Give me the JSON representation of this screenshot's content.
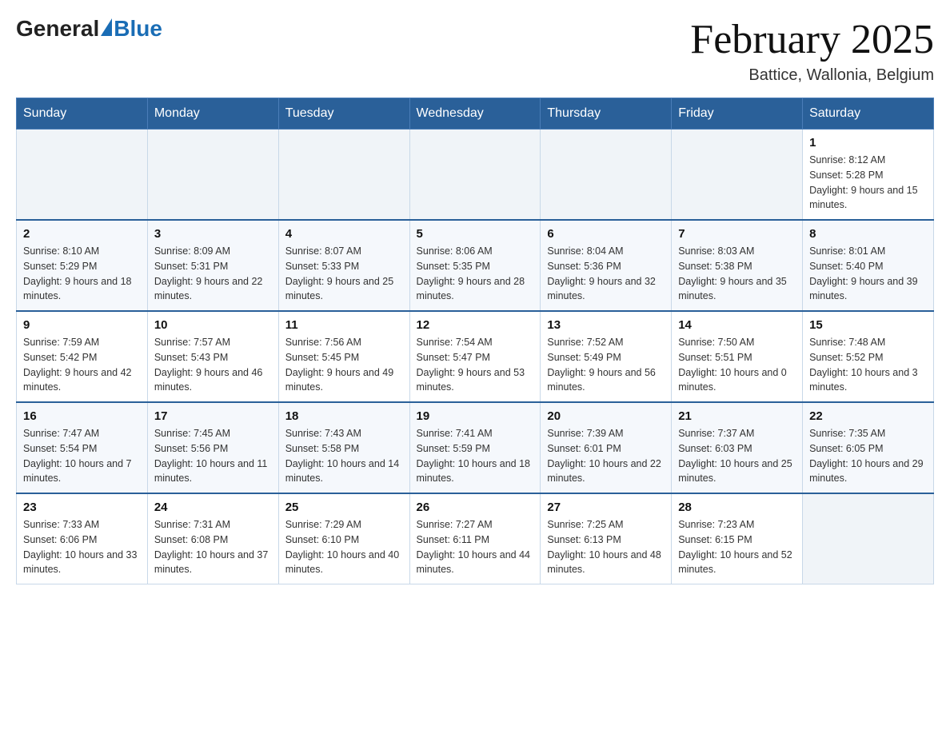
{
  "header": {
    "logo_general": "General",
    "logo_blue": "Blue",
    "month_title": "February 2025",
    "location": "Battice, Wallonia, Belgium"
  },
  "days_of_week": [
    "Sunday",
    "Monday",
    "Tuesday",
    "Wednesday",
    "Thursday",
    "Friday",
    "Saturday"
  ],
  "weeks": [
    [
      {
        "day": "",
        "sunrise": "",
        "sunset": "",
        "daylight": "",
        "empty": true
      },
      {
        "day": "",
        "sunrise": "",
        "sunset": "",
        "daylight": "",
        "empty": true
      },
      {
        "day": "",
        "sunrise": "",
        "sunset": "",
        "daylight": "",
        "empty": true
      },
      {
        "day": "",
        "sunrise": "",
        "sunset": "",
        "daylight": "",
        "empty": true
      },
      {
        "day": "",
        "sunrise": "",
        "sunset": "",
        "daylight": "",
        "empty": true
      },
      {
        "day": "",
        "sunrise": "",
        "sunset": "",
        "daylight": "",
        "empty": true
      },
      {
        "day": "1",
        "sunrise": "Sunrise: 8:12 AM",
        "sunset": "Sunset: 5:28 PM",
        "daylight": "Daylight: 9 hours and 15 minutes.",
        "empty": false
      }
    ],
    [
      {
        "day": "2",
        "sunrise": "Sunrise: 8:10 AM",
        "sunset": "Sunset: 5:29 PM",
        "daylight": "Daylight: 9 hours and 18 minutes.",
        "empty": false
      },
      {
        "day": "3",
        "sunrise": "Sunrise: 8:09 AM",
        "sunset": "Sunset: 5:31 PM",
        "daylight": "Daylight: 9 hours and 22 minutes.",
        "empty": false
      },
      {
        "day": "4",
        "sunrise": "Sunrise: 8:07 AM",
        "sunset": "Sunset: 5:33 PM",
        "daylight": "Daylight: 9 hours and 25 minutes.",
        "empty": false
      },
      {
        "day": "5",
        "sunrise": "Sunrise: 8:06 AM",
        "sunset": "Sunset: 5:35 PM",
        "daylight": "Daylight: 9 hours and 28 minutes.",
        "empty": false
      },
      {
        "day": "6",
        "sunrise": "Sunrise: 8:04 AM",
        "sunset": "Sunset: 5:36 PM",
        "daylight": "Daylight: 9 hours and 32 minutes.",
        "empty": false
      },
      {
        "day": "7",
        "sunrise": "Sunrise: 8:03 AM",
        "sunset": "Sunset: 5:38 PM",
        "daylight": "Daylight: 9 hours and 35 minutes.",
        "empty": false
      },
      {
        "day": "8",
        "sunrise": "Sunrise: 8:01 AM",
        "sunset": "Sunset: 5:40 PM",
        "daylight": "Daylight: 9 hours and 39 minutes.",
        "empty": false
      }
    ],
    [
      {
        "day": "9",
        "sunrise": "Sunrise: 7:59 AM",
        "sunset": "Sunset: 5:42 PM",
        "daylight": "Daylight: 9 hours and 42 minutes.",
        "empty": false
      },
      {
        "day": "10",
        "sunrise": "Sunrise: 7:57 AM",
        "sunset": "Sunset: 5:43 PM",
        "daylight": "Daylight: 9 hours and 46 minutes.",
        "empty": false
      },
      {
        "day": "11",
        "sunrise": "Sunrise: 7:56 AM",
        "sunset": "Sunset: 5:45 PM",
        "daylight": "Daylight: 9 hours and 49 minutes.",
        "empty": false
      },
      {
        "day": "12",
        "sunrise": "Sunrise: 7:54 AM",
        "sunset": "Sunset: 5:47 PM",
        "daylight": "Daylight: 9 hours and 53 minutes.",
        "empty": false
      },
      {
        "day": "13",
        "sunrise": "Sunrise: 7:52 AM",
        "sunset": "Sunset: 5:49 PM",
        "daylight": "Daylight: 9 hours and 56 minutes.",
        "empty": false
      },
      {
        "day": "14",
        "sunrise": "Sunrise: 7:50 AM",
        "sunset": "Sunset: 5:51 PM",
        "daylight": "Daylight: 10 hours and 0 minutes.",
        "empty": false
      },
      {
        "day": "15",
        "sunrise": "Sunrise: 7:48 AM",
        "sunset": "Sunset: 5:52 PM",
        "daylight": "Daylight: 10 hours and 3 minutes.",
        "empty": false
      }
    ],
    [
      {
        "day": "16",
        "sunrise": "Sunrise: 7:47 AM",
        "sunset": "Sunset: 5:54 PM",
        "daylight": "Daylight: 10 hours and 7 minutes.",
        "empty": false
      },
      {
        "day": "17",
        "sunrise": "Sunrise: 7:45 AM",
        "sunset": "Sunset: 5:56 PM",
        "daylight": "Daylight: 10 hours and 11 minutes.",
        "empty": false
      },
      {
        "day": "18",
        "sunrise": "Sunrise: 7:43 AM",
        "sunset": "Sunset: 5:58 PM",
        "daylight": "Daylight: 10 hours and 14 minutes.",
        "empty": false
      },
      {
        "day": "19",
        "sunrise": "Sunrise: 7:41 AM",
        "sunset": "Sunset: 5:59 PM",
        "daylight": "Daylight: 10 hours and 18 minutes.",
        "empty": false
      },
      {
        "day": "20",
        "sunrise": "Sunrise: 7:39 AM",
        "sunset": "Sunset: 6:01 PM",
        "daylight": "Daylight: 10 hours and 22 minutes.",
        "empty": false
      },
      {
        "day": "21",
        "sunrise": "Sunrise: 7:37 AM",
        "sunset": "Sunset: 6:03 PM",
        "daylight": "Daylight: 10 hours and 25 minutes.",
        "empty": false
      },
      {
        "day": "22",
        "sunrise": "Sunrise: 7:35 AM",
        "sunset": "Sunset: 6:05 PM",
        "daylight": "Daylight: 10 hours and 29 minutes.",
        "empty": false
      }
    ],
    [
      {
        "day": "23",
        "sunrise": "Sunrise: 7:33 AM",
        "sunset": "Sunset: 6:06 PM",
        "daylight": "Daylight: 10 hours and 33 minutes.",
        "empty": false
      },
      {
        "day": "24",
        "sunrise": "Sunrise: 7:31 AM",
        "sunset": "Sunset: 6:08 PM",
        "daylight": "Daylight: 10 hours and 37 minutes.",
        "empty": false
      },
      {
        "day": "25",
        "sunrise": "Sunrise: 7:29 AM",
        "sunset": "Sunset: 6:10 PM",
        "daylight": "Daylight: 10 hours and 40 minutes.",
        "empty": false
      },
      {
        "day": "26",
        "sunrise": "Sunrise: 7:27 AM",
        "sunset": "Sunset: 6:11 PM",
        "daylight": "Daylight: 10 hours and 44 minutes.",
        "empty": false
      },
      {
        "day": "27",
        "sunrise": "Sunrise: 7:25 AM",
        "sunset": "Sunset: 6:13 PM",
        "daylight": "Daylight: 10 hours and 48 minutes.",
        "empty": false
      },
      {
        "day": "28",
        "sunrise": "Sunrise: 7:23 AM",
        "sunset": "Sunset: 6:15 PM",
        "daylight": "Daylight: 10 hours and 52 minutes.",
        "empty": false
      },
      {
        "day": "",
        "sunrise": "",
        "sunset": "",
        "daylight": "",
        "empty": true
      }
    ]
  ]
}
